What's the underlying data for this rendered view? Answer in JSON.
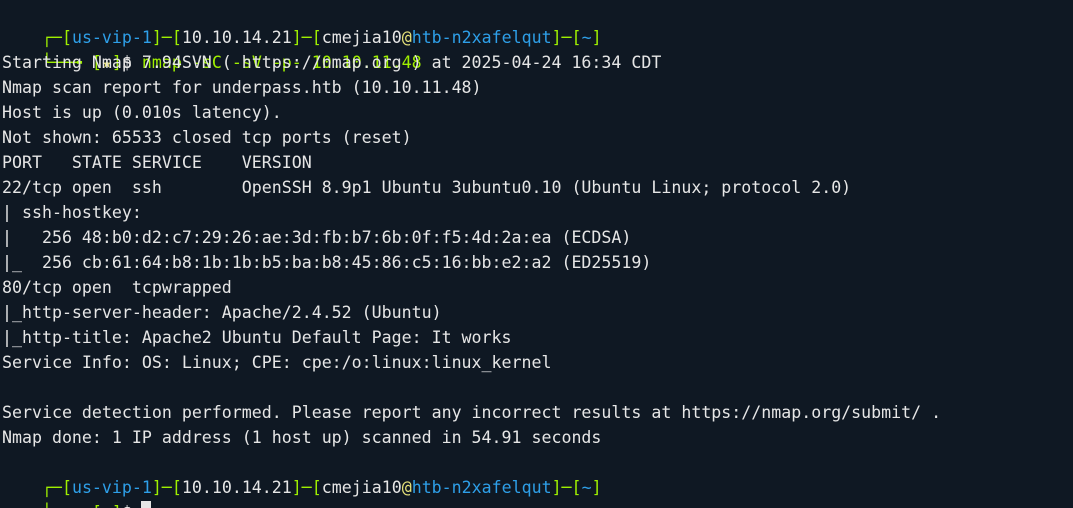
{
  "prompt": {
    "vpn": "us-vip-1",
    "ip": "10.10.14.21",
    "user": "cmejia10",
    "at": "@",
    "host": "htb-n2xafelqut",
    "dir": "~",
    "star": "★",
    "dollar": "$"
  },
  "command": "nmap -sC -sV -p- 10.10.11.48",
  "output": [
    "Starting Nmap 7.94SVN ( https://nmap.org ) at 2025-04-24 16:34 CDT",
    "Nmap scan report for underpass.htb (10.10.11.48)",
    "Host is up (0.010s latency).",
    "Not shown: 65533 closed tcp ports (reset)",
    "PORT   STATE SERVICE    VERSION",
    "22/tcp open  ssh        OpenSSH 8.9p1 Ubuntu 3ubuntu0.10 (Ubuntu Linux; protocol 2.0)",
    "| ssh-hostkey: ",
    "|   256 48:b0:d2:c7:29:26:ae:3d:fb:b7:6b:0f:f5:4d:2a:ea (ECDSA)",
    "|_  256 cb:61:64:b8:1b:1b:b5:ba:b8:45:86:c5:16:bb:e2:a2 (ED25519)",
    "80/tcp open  tcpwrapped",
    "|_http-server-header: Apache/2.4.52 (Ubuntu)",
    "|_http-title: Apache2 Ubuntu Default Page: It works",
    "Service Info: OS: Linux; CPE: cpe:/o:linux:linux_kernel",
    "",
    "Service detection performed. Please report any incorrect results at https://nmap.org/submit/ .",
    "Nmap done: 1 IP address (1 host up) scanned in 54.91 seconds"
  ]
}
